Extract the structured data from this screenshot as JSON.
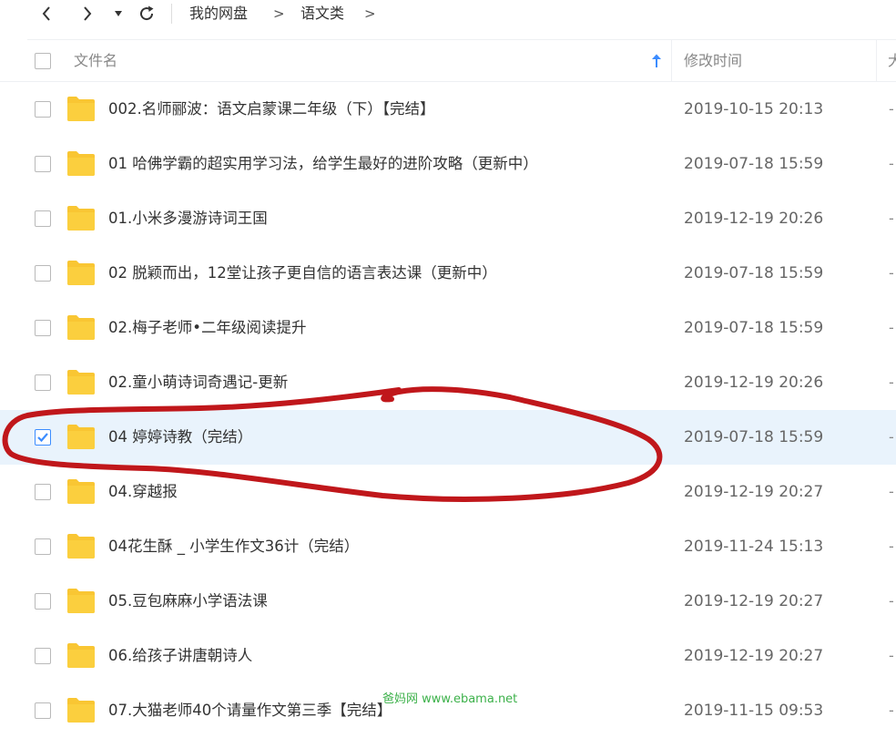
{
  "breadcrumb": {
    "items": [
      "我的网盘",
      "语文类"
    ],
    "separator": ">"
  },
  "columns": {
    "name": "文件名",
    "modified": "修改时间",
    "size": "大"
  },
  "accent_color": "#3b8cff",
  "folder_color": "#f9c633",
  "selected_row_color": "#e9f3fc",
  "annotation_color": "#c0171b",
  "files": [
    {
      "name": "002.名师郦波：语文启蒙课二年级（下）【完结】",
      "modified": "2019-10-15 20:13",
      "size": "-",
      "checked": false
    },
    {
      "name": "01 哈佛学霸的超实用学习法，给学生最好的进阶攻略（更新中）",
      "modified": "2019-07-18 15:59",
      "size": "-",
      "checked": false
    },
    {
      "name": "01.小米多漫游诗词王国",
      "modified": "2019-12-19 20:26",
      "size": "-",
      "checked": false
    },
    {
      "name": "02 脱颖而出，12堂让孩子更自信的语言表达课（更新中）",
      "modified": "2019-07-18 15:59",
      "size": "-",
      "checked": false
    },
    {
      "name": "02.梅子老师•二年级阅读提升",
      "modified": "2019-07-18 15:59",
      "size": "-",
      "checked": false
    },
    {
      "name": "02.童小萌诗词奇遇记-更新",
      "modified": "2019-12-19 20:26",
      "size": "-",
      "checked": false
    },
    {
      "name": "04 婷婷诗教（完结）",
      "modified": "2019-07-18 15:59",
      "size": "-",
      "checked": true
    },
    {
      "name": "04.穿越报",
      "modified": "2019-12-19 20:27",
      "size": "-",
      "checked": false
    },
    {
      "name": "04花生酥 _ 小学生作文36计（完结）",
      "modified": "2019-11-24 15:13",
      "size": "-",
      "checked": false
    },
    {
      "name": "05.豆包麻麻小学语法课",
      "modified": "2019-12-19 20:27",
      "size": "-",
      "checked": false
    },
    {
      "name": "06.给孩子讲唐朝诗人",
      "modified": "2019-12-19 20:27",
      "size": "-",
      "checked": false
    },
    {
      "name": "07.大猫老师40个请量作文第三季【完结】",
      "modified": "2019-11-15 09:53",
      "size": "-",
      "checked": false
    }
  ],
  "watermark": "爸妈网 www.ebama.net"
}
